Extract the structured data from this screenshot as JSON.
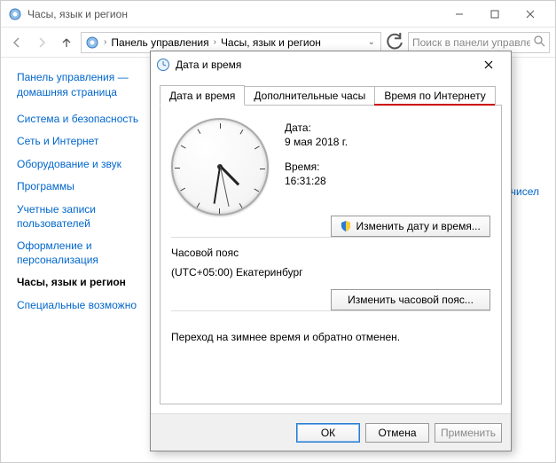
{
  "window": {
    "title": "Часы, язык и регион",
    "controls": {
      "minimize": "–",
      "maximize": "▢",
      "close": "✕"
    }
  },
  "nav": {
    "breadcrumb": {
      "level1": "Панель управления",
      "level2": "Часы, язык и регион"
    },
    "search_placeholder": "Поиск в панели управления"
  },
  "sidebar": {
    "home": "Панель управления — домашняя страница",
    "items": [
      {
        "label": "Система и безопасность",
        "active": false
      },
      {
        "label": "Сеть и Интернет",
        "active": false
      },
      {
        "label": "Оборудование и звук",
        "active": false
      },
      {
        "label": "Программы",
        "active": false
      },
      {
        "label": "Учетные записи пользователей",
        "active": false
      },
      {
        "label": "Оформление и персонализация",
        "active": false
      },
      {
        "label": "Часы, язык и регион",
        "active": true
      },
      {
        "label": "Специальные возможно",
        "active": false
      }
    ]
  },
  "content": {
    "link_fragment": "ени и чисел"
  },
  "dialog": {
    "title": "Дата и время",
    "tabs": [
      {
        "label": "Дата и время",
        "active": true
      },
      {
        "label": "Дополнительные часы",
        "active": false
      },
      {
        "label": "Время по Интернету",
        "active": false,
        "highlight": true
      }
    ],
    "date_label": "Дата:",
    "date_value": "9 мая 2018 г.",
    "time_label": "Время:",
    "time_value": "16:31:28",
    "change_dt_btn": "Изменить дату и время...",
    "tz_heading": "Часовой пояс",
    "tz_value": "(UTC+05:00) Екатеринбург",
    "change_tz_btn": "Изменить часовой пояс...",
    "dst_text": "Переход на зимнее время и обратно отменен.",
    "buttons": {
      "ok": "ОК",
      "cancel": "Отмена",
      "apply": "Применить"
    },
    "clock": {
      "hour": 16,
      "minute": 31,
      "second": 28
    }
  }
}
